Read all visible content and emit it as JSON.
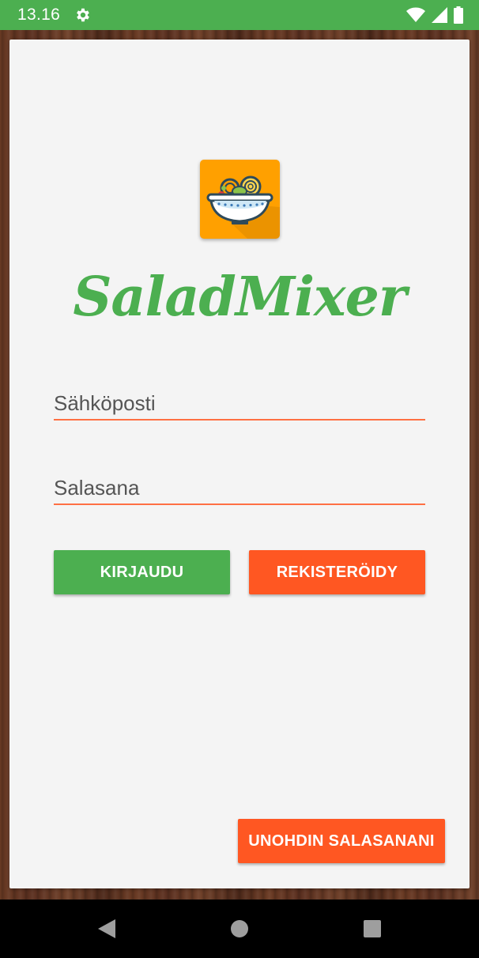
{
  "status_bar": {
    "time": "13.16",
    "icons": [
      "settings-gear-icon",
      "wifi-icon",
      "signal-icon",
      "battery-icon"
    ]
  },
  "app": {
    "name": "SaladMixer",
    "logo_icon": "salad-bowl-icon",
    "accent_color": "#4caf50",
    "secondary_color": "#ff5722",
    "logo_bg_color": "#ffa000"
  },
  "form": {
    "email": {
      "placeholder": "Sähköposti",
      "value": ""
    },
    "password": {
      "placeholder": "Salasana",
      "value": ""
    }
  },
  "buttons": {
    "login": "KIRJAUDU",
    "register": "REKISTERÖIDY",
    "forgot_password": "UNOHDIN SALASANANI"
  },
  "nav_bar": {
    "icons": [
      "back-triangle-icon",
      "home-circle-icon",
      "recents-square-icon"
    ]
  }
}
